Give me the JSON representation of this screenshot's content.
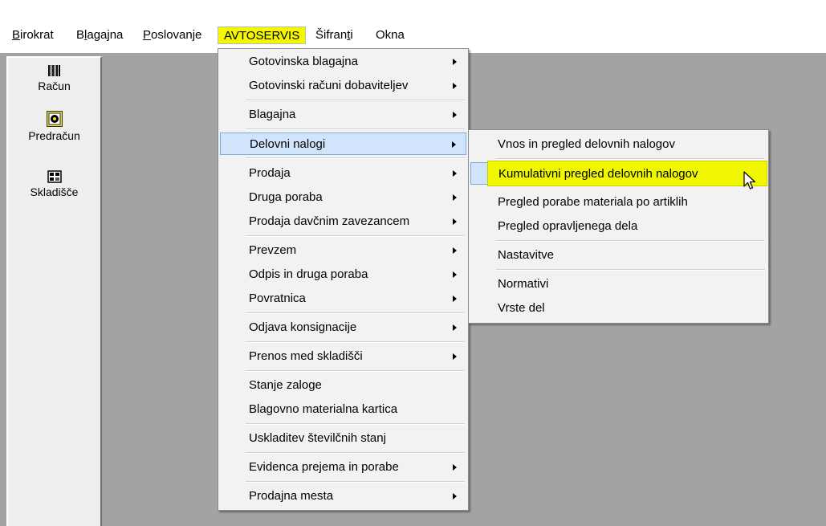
{
  "menubar": {
    "birokrat": {
      "first": "B",
      "rest": "irokrat"
    },
    "blagajna": {
      "first": "B",
      "u": "l",
      "rest": "agajna"
    },
    "poslovanje": {
      "first": "P",
      "rest": "oslovanje"
    },
    "avtoservis": "AVTOSERVIS",
    "sifranti": {
      "pre": "Šifran",
      "u": "t",
      "rest": "i"
    },
    "okna": "Okna"
  },
  "toolbox": {
    "items": [
      "Račun",
      "Predračun",
      "Skladišče"
    ]
  },
  "avtoservis_menu": {
    "items": [
      {
        "label": "Gotovinska blagajna",
        "submenu": true
      },
      {
        "label": "Gotovinski računi dobaviteljev",
        "submenu": true
      },
      {
        "label": "Blagajna",
        "submenu": true
      },
      {
        "label": "Delovni nalogi",
        "submenu": true,
        "selected": true
      },
      {
        "label": "Prodaja",
        "submenu": true
      },
      {
        "label": "Druga poraba",
        "submenu": true
      },
      {
        "label": "Prodaja davčnim zavezancem",
        "submenu": true
      },
      {
        "label": "Prevzem",
        "submenu": true
      },
      {
        "label": "Odpis in druga poraba",
        "submenu": true
      },
      {
        "label": "Povratnica",
        "submenu": true
      },
      {
        "label": "Odjava konsignacije",
        "submenu": true
      },
      {
        "label": "Prenos med skladišči",
        "submenu": true
      },
      {
        "label": "Stanje zaloge",
        "submenu": false
      },
      {
        "label": "Blagovno materialna kartica",
        "submenu": false
      },
      {
        "label": "Uskladitev številčnih stanj",
        "submenu": false
      },
      {
        "label": "Evidenca prejema in porabe",
        "submenu": true
      },
      {
        "label": "Prodajna mesta",
        "submenu": true
      }
    ]
  },
  "delovni_nalogi_submenu": {
    "items": [
      {
        "label": "Vnos in pregled delovnih nalogov"
      },
      {
        "label": "Kumulativni pregled delovnih nalogov",
        "selected": true
      },
      {
        "label": "Pregled porabe materiala po artiklih"
      },
      {
        "label": "Pregled opravljenega dela"
      },
      {
        "label": "Nastavitve"
      },
      {
        "label": "Normativi"
      },
      {
        "label": "Vrste del"
      }
    ]
  },
  "colors": {
    "highlight_yellow": "#f3f700",
    "selection_blue": "#d0e5fb",
    "workspace_gray": "#a3a3a3"
  }
}
